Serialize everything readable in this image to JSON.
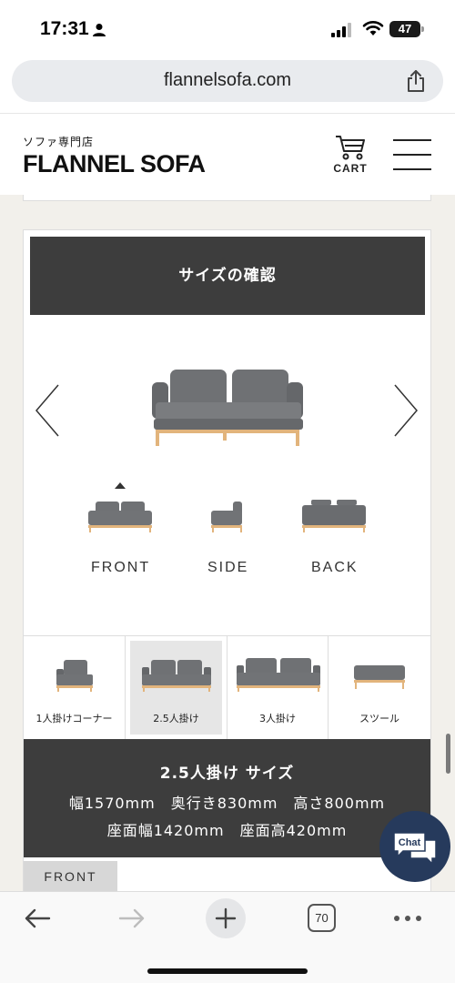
{
  "status": {
    "time": "17:31",
    "battery": "47"
  },
  "browser": {
    "url": "flannelsofa.com",
    "tabs_count": "70"
  },
  "header": {
    "subtitle": "ソファ専門店",
    "logo": "FLANNEL SOFA",
    "cart_label": "CART"
  },
  "size_section": {
    "heading": "サイズの確認",
    "views": [
      {
        "label": "FRONT",
        "selected": true
      },
      {
        "label": "SIDE",
        "selected": false
      },
      {
        "label": "BACK",
        "selected": false
      }
    ],
    "size_tabs": [
      {
        "label": "1人掛けコーナー",
        "selected": false
      },
      {
        "label": "2.5人掛け",
        "selected": true
      },
      {
        "label": "3人掛け",
        "selected": false
      },
      {
        "label": "スツール",
        "selected": false
      }
    ],
    "spec": {
      "title": "2.5人掛け サイズ",
      "line1": "幅1570mm　奥行き830mm　高さ800mm",
      "line2": "座面幅1420mm　座面高420mm"
    },
    "view_tag": "FRONT"
  },
  "chat": {
    "label": "Chat"
  },
  "colors": {
    "dark_panel": "#3d3d3d",
    "page_bg": "#f2f0eb",
    "sofa_gray": "#6b6d70",
    "wood": "#e2b47c",
    "chat_bg": "#263a5c"
  }
}
